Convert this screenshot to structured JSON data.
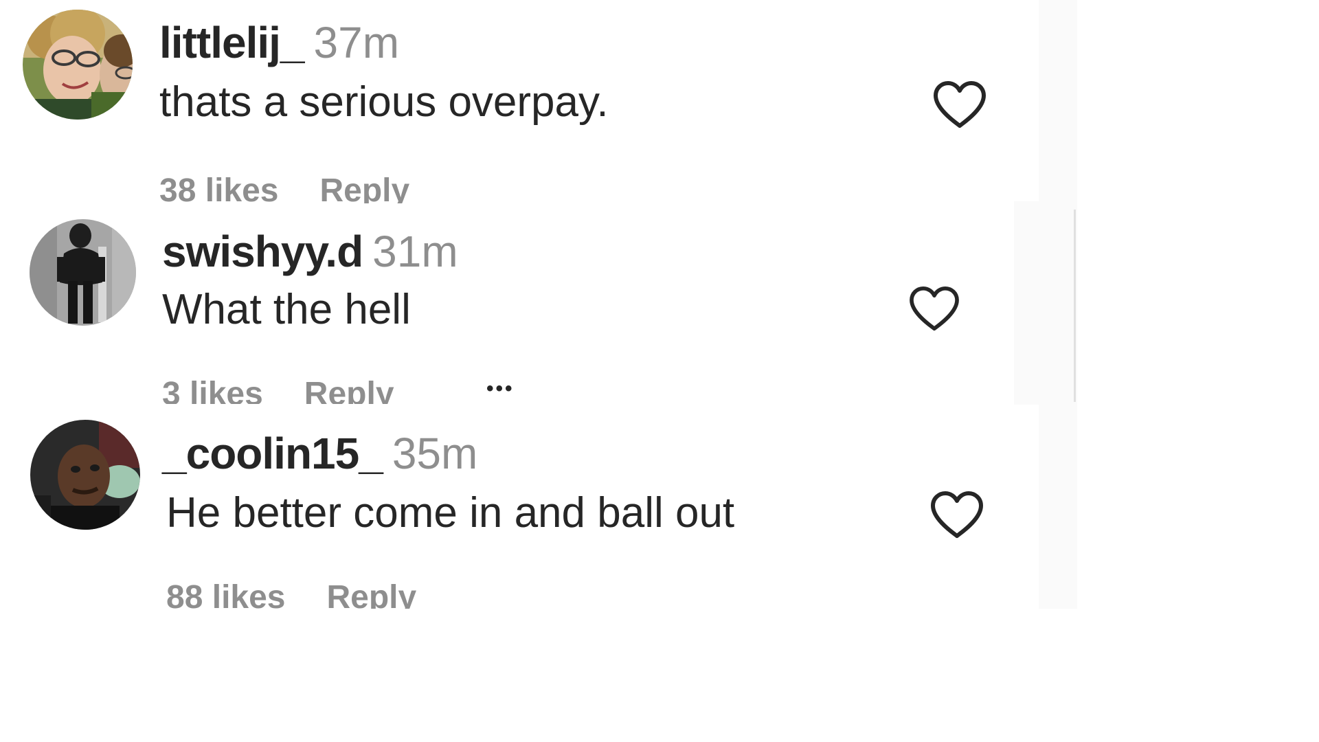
{
  "comments": [
    {
      "username": "littlelij_",
      "time": "37m",
      "text": "thats a serious overpay.",
      "likes": "38 likes",
      "reply_label": "Reply"
    },
    {
      "username": "swishyy.d",
      "time": "31m",
      "text": "What the hell",
      "likes": "3 likes",
      "reply_label": "Reply",
      "more_label": "•••"
    },
    {
      "username": "_coolin15_",
      "time": "35m",
      "text": "He better come in and ball out",
      "likes": "88 likes",
      "reply_label": "Reply"
    }
  ],
  "icons": {
    "like": "heart-outline-icon",
    "avatar": "profile-avatar"
  },
  "colors": {
    "text_primary": "#262626",
    "text_secondary": "#8e8e8e",
    "background": "#ffffff",
    "side_panel": "#fafafa"
  }
}
